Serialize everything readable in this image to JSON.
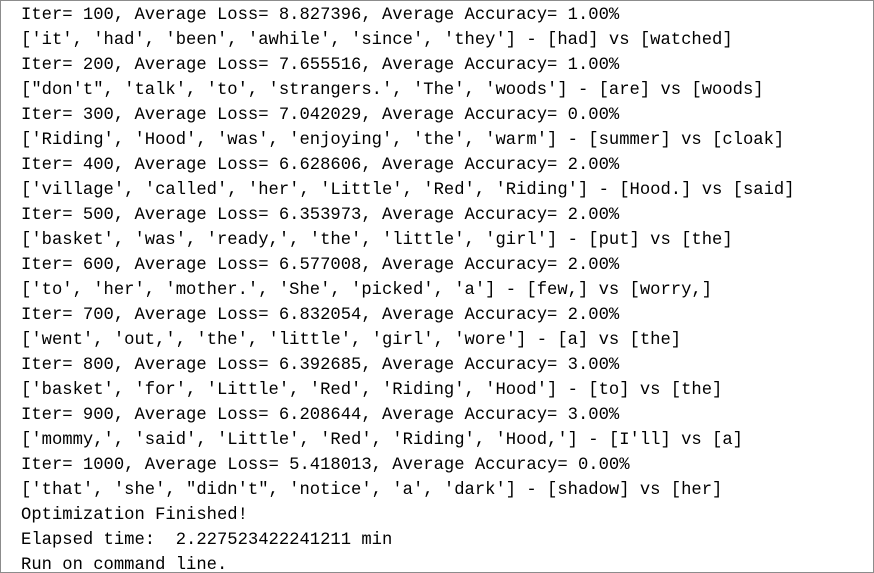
{
  "console": {
    "lines": [
      "Iter= 100, Average Loss= 8.827396, Average Accuracy= 1.00%",
      "['it', 'had', 'been', 'awhile', 'since', 'they'] - [had] vs [watched]",
      "Iter= 200, Average Loss= 7.655516, Average Accuracy= 1.00%",
      "[\"don't\", 'talk', 'to', 'strangers.', 'The', 'woods'] - [are] vs [woods]",
      "Iter= 300, Average Loss= 7.042029, Average Accuracy= 0.00%",
      "['Riding', 'Hood', 'was', 'enjoying', 'the', 'warm'] - [summer] vs [cloak]",
      "Iter= 400, Average Loss= 6.628606, Average Accuracy= 2.00%",
      "['village', 'called', 'her', 'Little', 'Red', 'Riding'] - [Hood.] vs [said]",
      "Iter= 500, Average Loss= 6.353973, Average Accuracy= 2.00%",
      "['basket', 'was', 'ready,', 'the', 'little', 'girl'] - [put] vs [the]",
      "Iter= 600, Average Loss= 6.577008, Average Accuracy= 2.00%",
      "['to', 'her', 'mother.', 'She', 'picked', 'a'] - [few,] vs [worry,]",
      "Iter= 700, Average Loss= 6.832054, Average Accuracy= 2.00%",
      "['went', 'out,', 'the', 'little', 'girl', 'wore'] - [a] vs [the]",
      "Iter= 800, Average Loss= 6.392685, Average Accuracy= 3.00%",
      "['basket', 'for', 'Little', 'Red', 'Riding', 'Hood'] - [to] vs [the]",
      "Iter= 900, Average Loss= 6.208644, Average Accuracy= 3.00%",
      "['mommy,', 'said', 'Little', 'Red', 'Riding', 'Hood,'] - [I'll] vs [a]",
      "Iter= 1000, Average Loss= 5.418013, Average Accuracy= 0.00%",
      "['that', 'she', \"didn't\", 'notice', 'a', 'dark'] - [shadow] vs [her]",
      "Optimization Finished!",
      "Elapsed time:  2.227523422241211 min",
      "Run on command line."
    ]
  }
}
